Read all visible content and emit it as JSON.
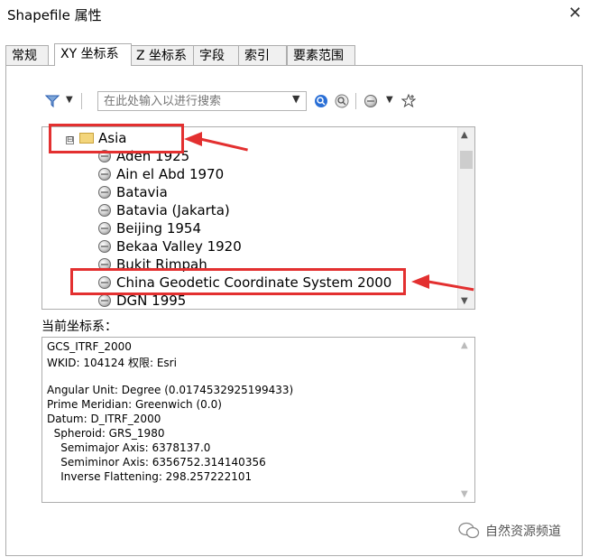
{
  "window": {
    "title": "Shapefile 属性",
    "close_glyph": "✕"
  },
  "tabs": [
    {
      "label": "常规"
    },
    {
      "label": "XY 坐标系"
    },
    {
      "label": "Z 坐标系"
    },
    {
      "label": "字段"
    },
    {
      "label": "索引"
    },
    {
      "label": "要素范围"
    }
  ],
  "toolbar": {
    "filter_icon": "filter-icon",
    "search_placeholder": "在此处输入以进行搜索",
    "search_button_icon": "search-icon",
    "clear_search_icon": "clear-search-icon",
    "globe_menu_icon": "globe-icon",
    "add_favorite_icon": "add-favorite-icon"
  },
  "tree": {
    "group": {
      "label": "Asia",
      "expander": "⊟"
    },
    "items": [
      "Aden 1925",
      "Ain el Abd 1970",
      "Batavia",
      "Batavia (Jakarta)",
      "Beijing 1954",
      "Bekaa Valley 1920",
      "Bukit Rimpah",
      "China Geodetic Coordinate System 2000",
      "DGN 1995"
    ]
  },
  "current_crs": {
    "label": "当前坐标系：",
    "lines": [
      "GCS_ITRF_2000",
      "WKID: 104124 权限: Esri",
      "",
      "Angular Unit: Degree (0.0174532925199433)",
      "Prime Meridian: Greenwich (0.0)",
      "Datum: D_ITRF_2000",
      "  Spheroid: GRS_1980",
      "    Semimajor Axis: 6378137.0",
      "    Semiminor Axis: 6356752.314140356",
      "    Inverse Flattening: 298.257222101"
    ]
  },
  "watermark": {
    "text": "自然资源频道"
  },
  "colors": {
    "annotation_red": "#e33030",
    "border": "#adadad"
  }
}
